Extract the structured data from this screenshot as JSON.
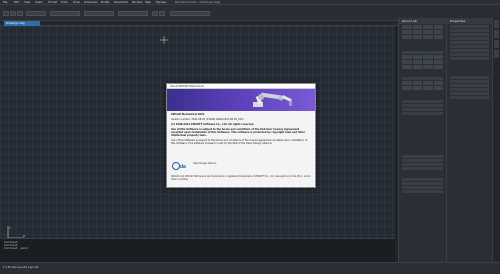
{
  "menubar": {
    "items": [
      "File",
      "Edit",
      "View",
      "Insert",
      "Format",
      "Tools",
      "Draw",
      "Dimension",
      "Modify",
      "Parametric",
      "Window",
      "Help",
      "Express"
    ],
    "title": "Mechanical 2021 - [Drawing1.dwg]"
  },
  "tabs": {
    "active": "Drawing1.dwg"
  },
  "panels": {
    "left_title": "Quick Lab",
    "right_title": "Properties"
  },
  "dialog": {
    "title": "About ZWCAD Mechanical",
    "product": "ZWCAD Mechanical 2021",
    "version": "Version number: 2021.08.05 (13949) 64bit(2021.08.05_x64)",
    "license_1": "(C) 1998-2021 ZWSOFT Software Co., Ltd. All rights reserved.",
    "license_2": "Use of this Software is subject to the terms and conditions of the End-User License Agreement accepted upon installation of this Software. This software is protected by copyright laws and other intellectual property laws.",
    "license_3": "Use of this Software is subject to the terms and conditions of the license agreement accepted upon installation of this Software. This software is based in part by the SDK of the Open Design Alliance.",
    "logo_text": "Open Design Alliance",
    "copyright": "ZWCAD and ZWCAD Mechanical are trademarks or registered trademarks of ZWSOFT Co., Ltd. (Guangzhou) in the P.R.C. and/or other countries."
  },
  "command": {
    "lines": [
      "Command:",
      "Command:",
      "Command: _about"
    ]
  },
  "status": {
    "text": "1:1  Model  Layout1  Layout2"
  },
  "colors": {
    "accent": "#2c6fb0",
    "banner": "#5a3fb8"
  }
}
